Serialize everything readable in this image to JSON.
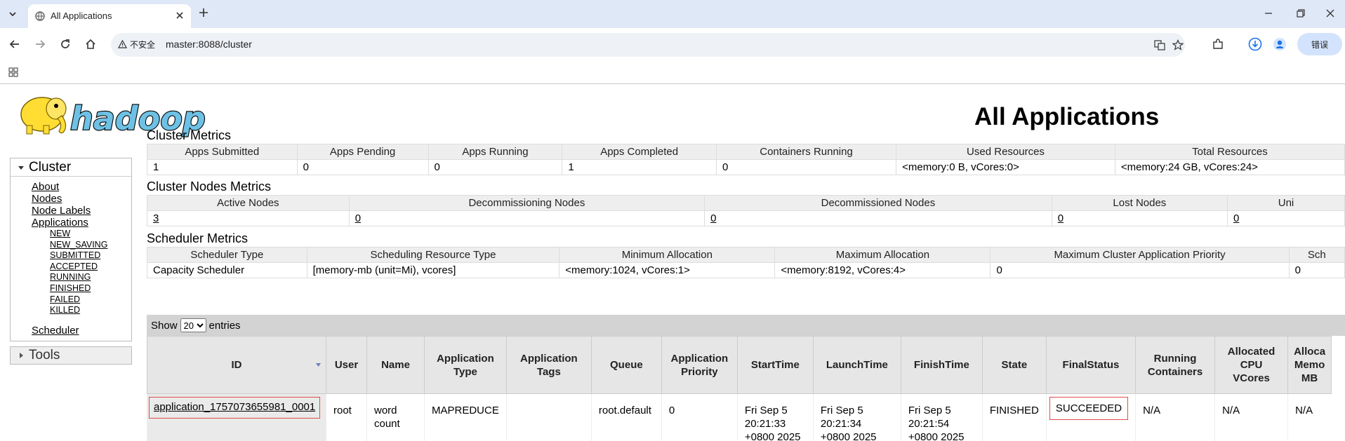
{
  "browser": {
    "tab_title": "All Applications",
    "security_label": "不安全",
    "url": "master:8088/cluster",
    "profile_label": "错误"
  },
  "page": {
    "title": "All Applications",
    "logo_text": "hadoop"
  },
  "nav": {
    "cluster_label": "Cluster",
    "links": [
      "About",
      "Nodes",
      "Node Labels",
      "Applications"
    ],
    "app_states": [
      "NEW",
      "NEW_SAVING",
      "SUBMITTED",
      "ACCEPTED",
      "RUNNING",
      "FINISHED",
      "FAILED",
      "KILLED"
    ],
    "scheduler": "Scheduler",
    "tools_label": "Tools"
  },
  "cluster_metrics": {
    "title": "Cluster Metrics",
    "headers": [
      "Apps Submitted",
      "Apps Pending",
      "Apps Running",
      "Apps Completed",
      "Containers Running",
      "Used Resources",
      "Total Resources"
    ],
    "values": [
      "1",
      "0",
      "0",
      "1",
      "0",
      "<memory:0 B, vCores:0>",
      "<memory:24 GB, vCores:24>"
    ]
  },
  "node_metrics": {
    "title": "Cluster Nodes Metrics",
    "headers": [
      "Active Nodes",
      "Decommissioning Nodes",
      "Decommissioned Nodes",
      "Lost Nodes",
      "Uni"
    ],
    "values": [
      "3",
      "0",
      "0",
      "0",
      "0"
    ]
  },
  "scheduler_metrics": {
    "title": "Scheduler Metrics",
    "headers": [
      "Scheduler Type",
      "Scheduling Resource Type",
      "Minimum Allocation",
      "Maximum Allocation",
      "Maximum Cluster Application Priority",
      "Sch"
    ],
    "values": [
      "Capacity Scheduler",
      "[memory-mb (unit=Mi), vcores]",
      "<memory:1024, vCores:1>",
      "<memory:8192, vCores:4>",
      "0",
      "0"
    ]
  },
  "apps": {
    "show_label": "Show",
    "page_size": "20",
    "entries_label": "entries",
    "headers": [
      "ID",
      "User",
      "Name",
      "Application Type",
      "Application Tags",
      "Queue",
      "Application Priority",
      "StartTime",
      "LaunchTime",
      "FinishTime",
      "State",
      "FinalStatus",
      "Running Containers",
      "Allocated CPU VCores",
      "Alloca Memo MB"
    ],
    "row": {
      "id": "application_1757073655981_0001",
      "user": "root",
      "name": "word count",
      "type": "MAPREDUCE",
      "tags": "",
      "queue": "root.default",
      "priority": "0",
      "start": "Fri Sep 5 20:21:33 +0800 2025",
      "launch": "Fri Sep 5 20:21:34 +0800 2025",
      "finish": "Fri Sep 5 20:21:54 +0800 2025",
      "state": "FINISHED",
      "final_status": "SUCCEEDED",
      "running_containers": "N/A",
      "alloc_vcores": "N/A",
      "alloc_mem": "N/A"
    }
  }
}
